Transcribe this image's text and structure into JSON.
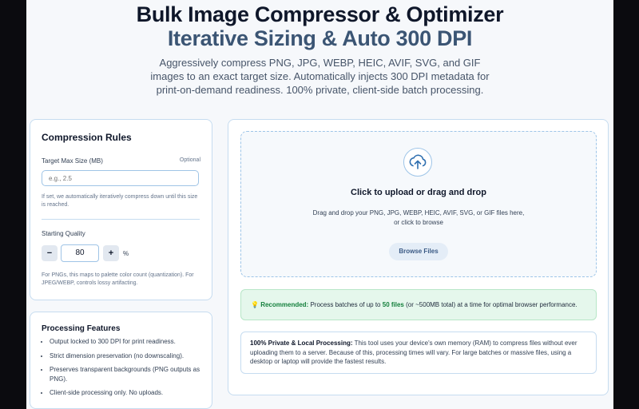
{
  "header": {
    "title_line1": "Bulk Image Compressor & Optimizer",
    "title_line2": "Iterative Sizing & Auto 300 DPI",
    "subtitle": "Aggressively compress PNG, JPG, WEBP, HEIC, AVIF, SVG, and GIF images to an exact target size. Automatically injects 300 DPI metadata for print-on-demand readiness. 100% private, client-side batch processing."
  },
  "rules": {
    "title": "Compression Rules",
    "target_label": "Target Max Size (MB)",
    "optional_label": "Optional",
    "target_placeholder": "e.g., 2.5",
    "target_help": "If set, we automatically iteratively compress down until this size is reached.",
    "quality_label": "Starting Quality",
    "decrement_label": "−",
    "quality_value": "80",
    "increment_label": "+",
    "percent_label": "%",
    "quality_help": "For PNGs, this maps to palette color count (quantization). For JPEG/WEBP, controls lossy artifacting."
  },
  "features": {
    "title": "Processing Features",
    "items": [
      "Output locked to 300 DPI for print readiness.",
      "Strict dimension preservation (no downscaling).",
      "Preserves transparent backgrounds (PNG outputs as PNG).",
      "Client-side processing only. No uploads."
    ]
  },
  "upload": {
    "icon": "cloud-upload-icon",
    "title": "Click to upload or drag and drop",
    "desc_line1": "Drag and drop your PNG, JPG, WEBP, HEIC, AVIF, SVG, or GIF files here,",
    "desc_line2": "or click to browse",
    "browse_label": "Browse Files"
  },
  "recommend": {
    "icon": "lightbulb-icon",
    "label": "Recommended:",
    "text_before": "Process batches of up to",
    "bold": "50 files",
    "text_after": "(or ~500MB total) at a time for optimal browser performance."
  },
  "privacy": {
    "label": "100% Private & Local Processing:",
    "text": "This tool uses your device's own memory (RAM) to compress files without ever uploading them to a server. Because of this, processing times will vary. For large batches or massive files, using a desktop or laptop will provide the fastest results."
  },
  "colors": {
    "accent": "#3b5574",
    "card_border": "#c6dcf0",
    "success_bg": "#e5f7ec"
  }
}
